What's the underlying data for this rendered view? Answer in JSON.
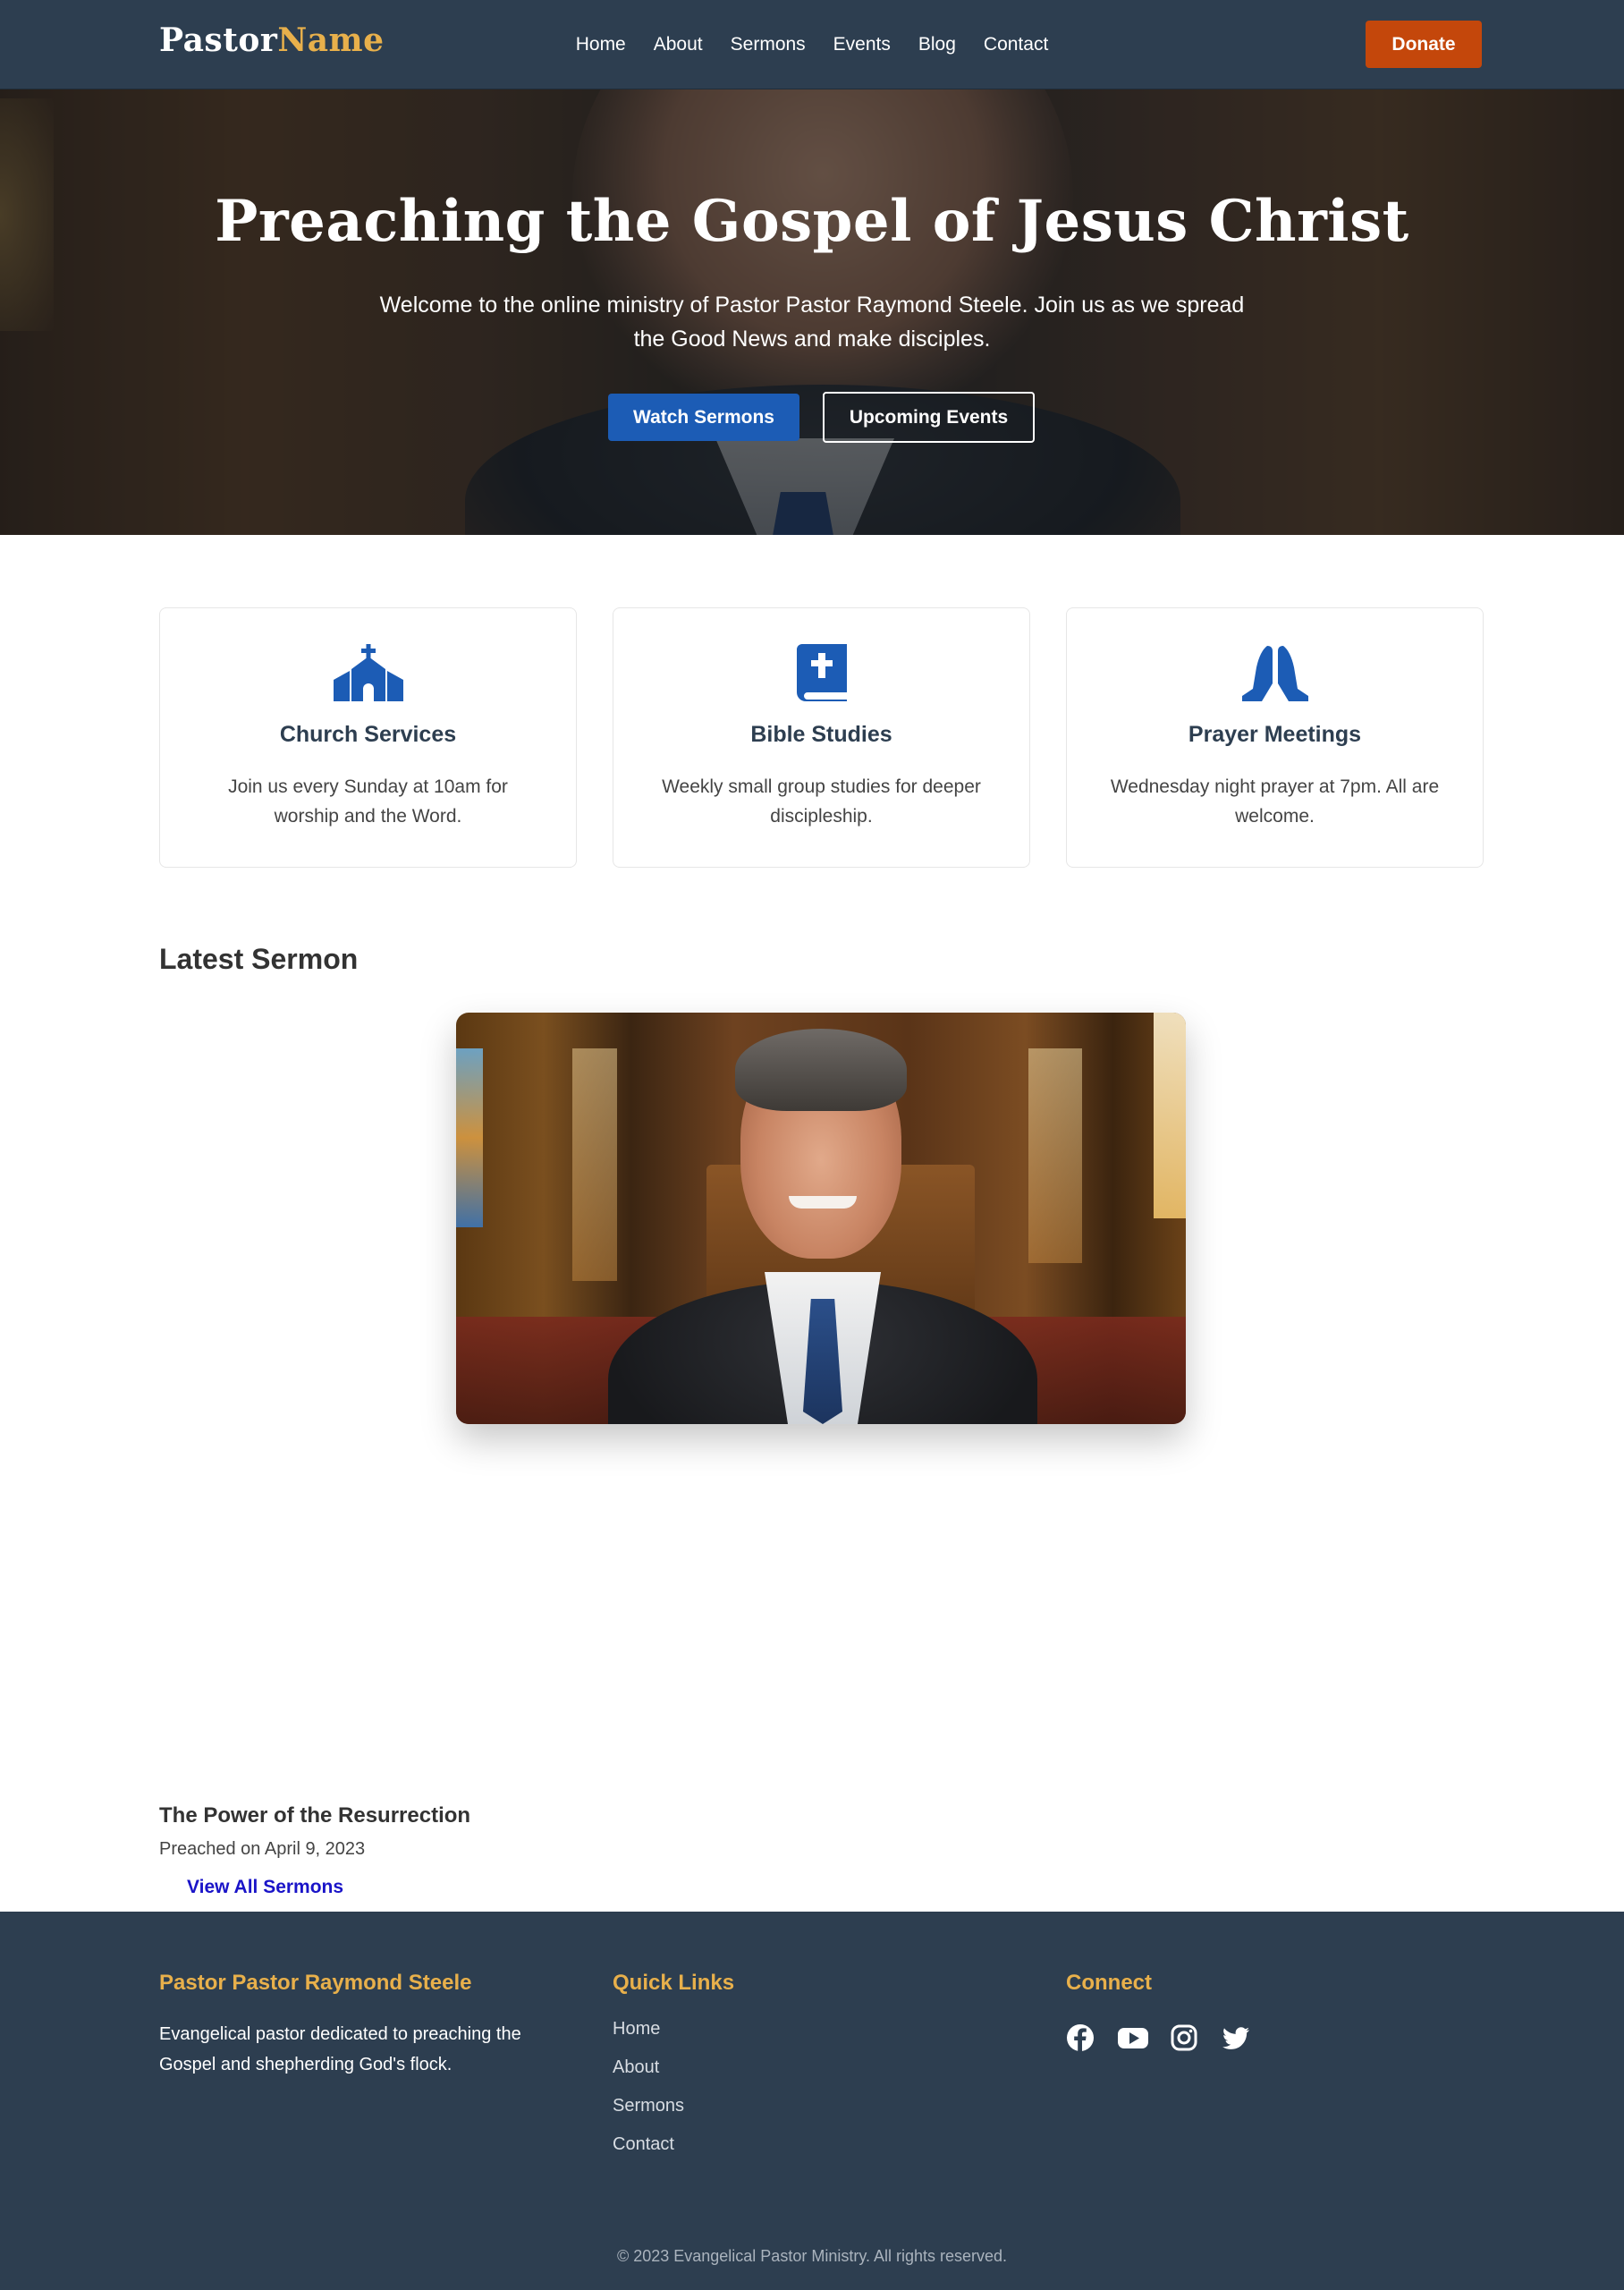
{
  "header": {
    "logo_main": "Pastor",
    "logo_accent": "Name",
    "nav": [
      "Home",
      "About",
      "Sermons",
      "Events",
      "Blog",
      "Contact"
    ],
    "donate_label": "Donate"
  },
  "hero": {
    "title": "Preaching the Gospel of Jesus Christ",
    "subtitle": "Welcome to the online ministry of Pastor Pastor Raymond Steele. Join us as we spread the Good News and make disciples.",
    "primary_button": "Watch Sermons",
    "secondary_button": "Upcoming Events"
  },
  "features": [
    {
      "icon": "church-icon",
      "title": "Church Services",
      "text": "Join us every Sunday at 10am for worship and the Word."
    },
    {
      "icon": "bible-icon",
      "title": "Bible Studies",
      "text": "Weekly small group studies for deeper discipleship."
    },
    {
      "icon": "praying-hands-icon",
      "title": "Prayer Meetings",
      "text": "Wednesday night prayer at 7pm. All are welcome."
    }
  ],
  "sermon": {
    "section_title": "Latest Sermon",
    "title": "The Power of the Resurrection",
    "date": "Preached on April 9, 2023",
    "view_all": "View All Sermons"
  },
  "footer": {
    "about_heading": "Pastor Pastor Raymond Steele",
    "about_text": "Evangelical pastor dedicated to preaching the Gospel and shepherding God's flock.",
    "links_heading": "Quick Links",
    "links": [
      "Home",
      "About",
      "Sermons",
      "Contact"
    ],
    "connect_heading": "Connect",
    "social": [
      "facebook-icon",
      "youtube-icon",
      "instagram-icon",
      "twitter-icon"
    ],
    "copyright": "© 2023 Evangelical Pastor Ministry. All rights reserved."
  },
  "colors": {
    "navy": "#2d3e50",
    "gold": "#e8b04b",
    "donate_orange": "#c4470b",
    "primary_blue": "#1c5cb5",
    "link_blue": "#1a14c8"
  }
}
